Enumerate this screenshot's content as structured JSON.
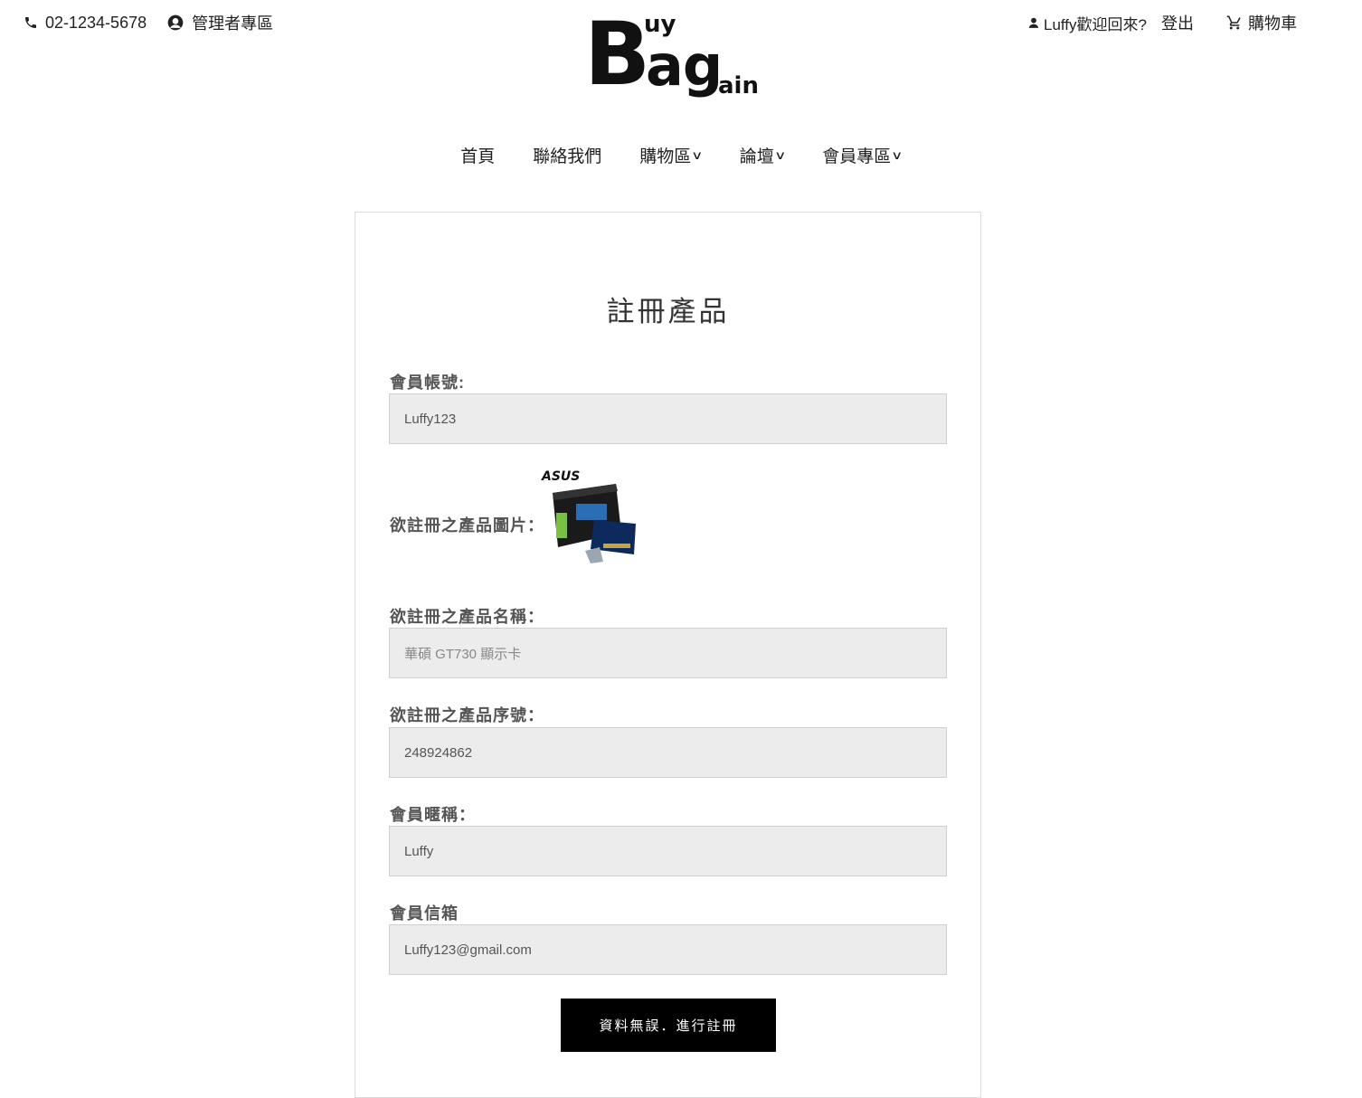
{
  "topbar": {
    "phone": "02-1234-5678",
    "admin_link": "管理者專區",
    "greeting": "Luffy歡迎回來?",
    "logout": "登出",
    "cart": "購物車"
  },
  "logo": {
    "line1_big": "B",
    "line1_small": "uy",
    "line2_big": "ag",
    "line2_small": "ain"
  },
  "nav": {
    "items": [
      {
        "label": "首頁",
        "has_dropdown": false
      },
      {
        "label": "聯絡我們",
        "has_dropdown": false
      },
      {
        "label": "購物區",
        "has_dropdown": true
      },
      {
        "label": "論壇",
        "has_dropdown": true
      },
      {
        "label": "會員專區",
        "has_dropdown": true
      }
    ],
    "chevron": "∨"
  },
  "form": {
    "title": "註冊產品",
    "account_label": "會員帳號:",
    "account_value": "Luffy123",
    "image_label": "欲註冊之產品圖片：",
    "image_brand": "ASUS",
    "name_label": "欲註冊之產品名稱：",
    "name_placeholder": "華碩 GT730 顯示卡",
    "serial_label": "欲註冊之產品序號：",
    "serial_value": "248924862",
    "nickname_label": "會員暱稱：",
    "nickname_value": "Luffy",
    "email_label": "會員信箱",
    "email_value": "Luffy123@gmail.com",
    "submit": "資料無誤．進行註冊"
  },
  "colors": {
    "accent": "#000000",
    "input_bg": "#ececec",
    "label": "#555555"
  }
}
